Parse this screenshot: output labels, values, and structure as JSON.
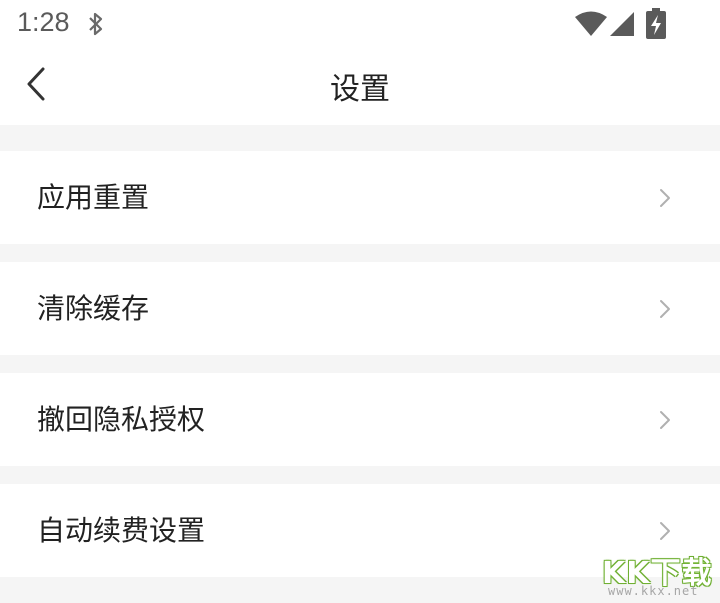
{
  "status_bar": {
    "time": "1:28",
    "icons": [
      "bluetooth-icon",
      "wifi-icon",
      "signal-icon",
      "battery-charging-icon"
    ]
  },
  "app_bar": {
    "back_icon": "chevron-left-icon",
    "title": "设置"
  },
  "settings": {
    "items": [
      {
        "label": "应用重置",
        "icon": "chevron-right-icon"
      },
      {
        "label": "清除缓存",
        "icon": "chevron-right-icon"
      },
      {
        "label": "撤回隐私授权",
        "icon": "chevron-right-icon"
      },
      {
        "label": "自动续费设置",
        "icon": "chevron-right-icon"
      }
    ]
  },
  "watermark": {
    "logo": "KK下载",
    "url": "www.kkx.net"
  },
  "colors": {
    "background": "#f5f5f5",
    "surface": "#ffffff",
    "text": "#222222",
    "chevron": "#b0b0b0",
    "status_icons": "#5a5a5a"
  }
}
